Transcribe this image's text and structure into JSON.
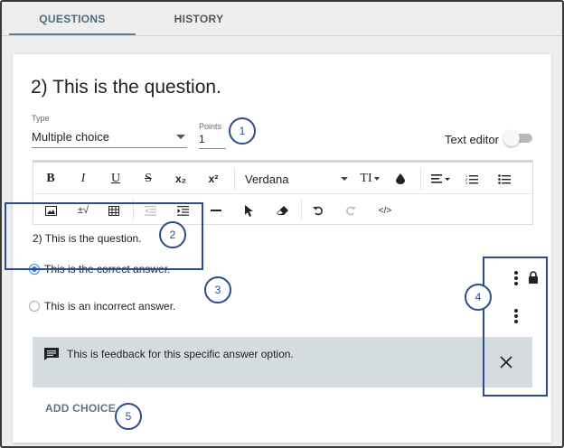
{
  "tabs": [
    {
      "label": "QUESTIONS",
      "active": true
    },
    {
      "label": "HISTORY",
      "active": false
    }
  ],
  "question": {
    "title": "2) This is the question.",
    "type_label": "Type",
    "type_value": "Multiple choice",
    "points_label": "Points",
    "points_value": "1",
    "text_editor_label": "Text editor",
    "text_editor_on": false
  },
  "toolbar": {
    "row1": [
      {
        "name": "bold-button",
        "label": "B"
      },
      {
        "name": "italic-button",
        "label": "I"
      },
      {
        "name": "underline-button",
        "label": "U"
      },
      {
        "name": "strikethrough-button",
        "label": "S"
      },
      {
        "name": "subscript-button",
        "label": "x₂"
      },
      {
        "name": "superscript-button",
        "label": "x²"
      }
    ],
    "font_name": "Verdana",
    "text_size_label": "TI",
    "row2_math_label": "±√",
    "code_label": "</>"
  },
  "preview_text": "2)   This is the question.",
  "choices": [
    {
      "text": "This is the correct answer.",
      "selected": true
    },
    {
      "text": "This is an incorrect answer.",
      "selected": false
    }
  ],
  "feedback_text": "This is feedback for this specific answer option.",
  "add_choice_label": "ADD CHOICE",
  "callouts": [
    "1",
    "2",
    "3",
    "4",
    "5"
  ],
  "colors": {
    "accent": "#5f7e93",
    "radio_checked": "#2e86de",
    "feedback_bg": "#d5dce0",
    "callout_border": "#2d4c8e"
  },
  "icons": [
    "ink-drop-icon",
    "align-icon",
    "numbered-list-icon",
    "bulleted-list-icon",
    "image-icon",
    "table-icon",
    "outdent-icon",
    "indent-icon",
    "horizontal-rule-icon",
    "cursor-icon",
    "eraser-icon",
    "undo-icon",
    "redo-icon",
    "comment-icon",
    "close-icon",
    "kebab-icon",
    "lock-icon"
  ]
}
